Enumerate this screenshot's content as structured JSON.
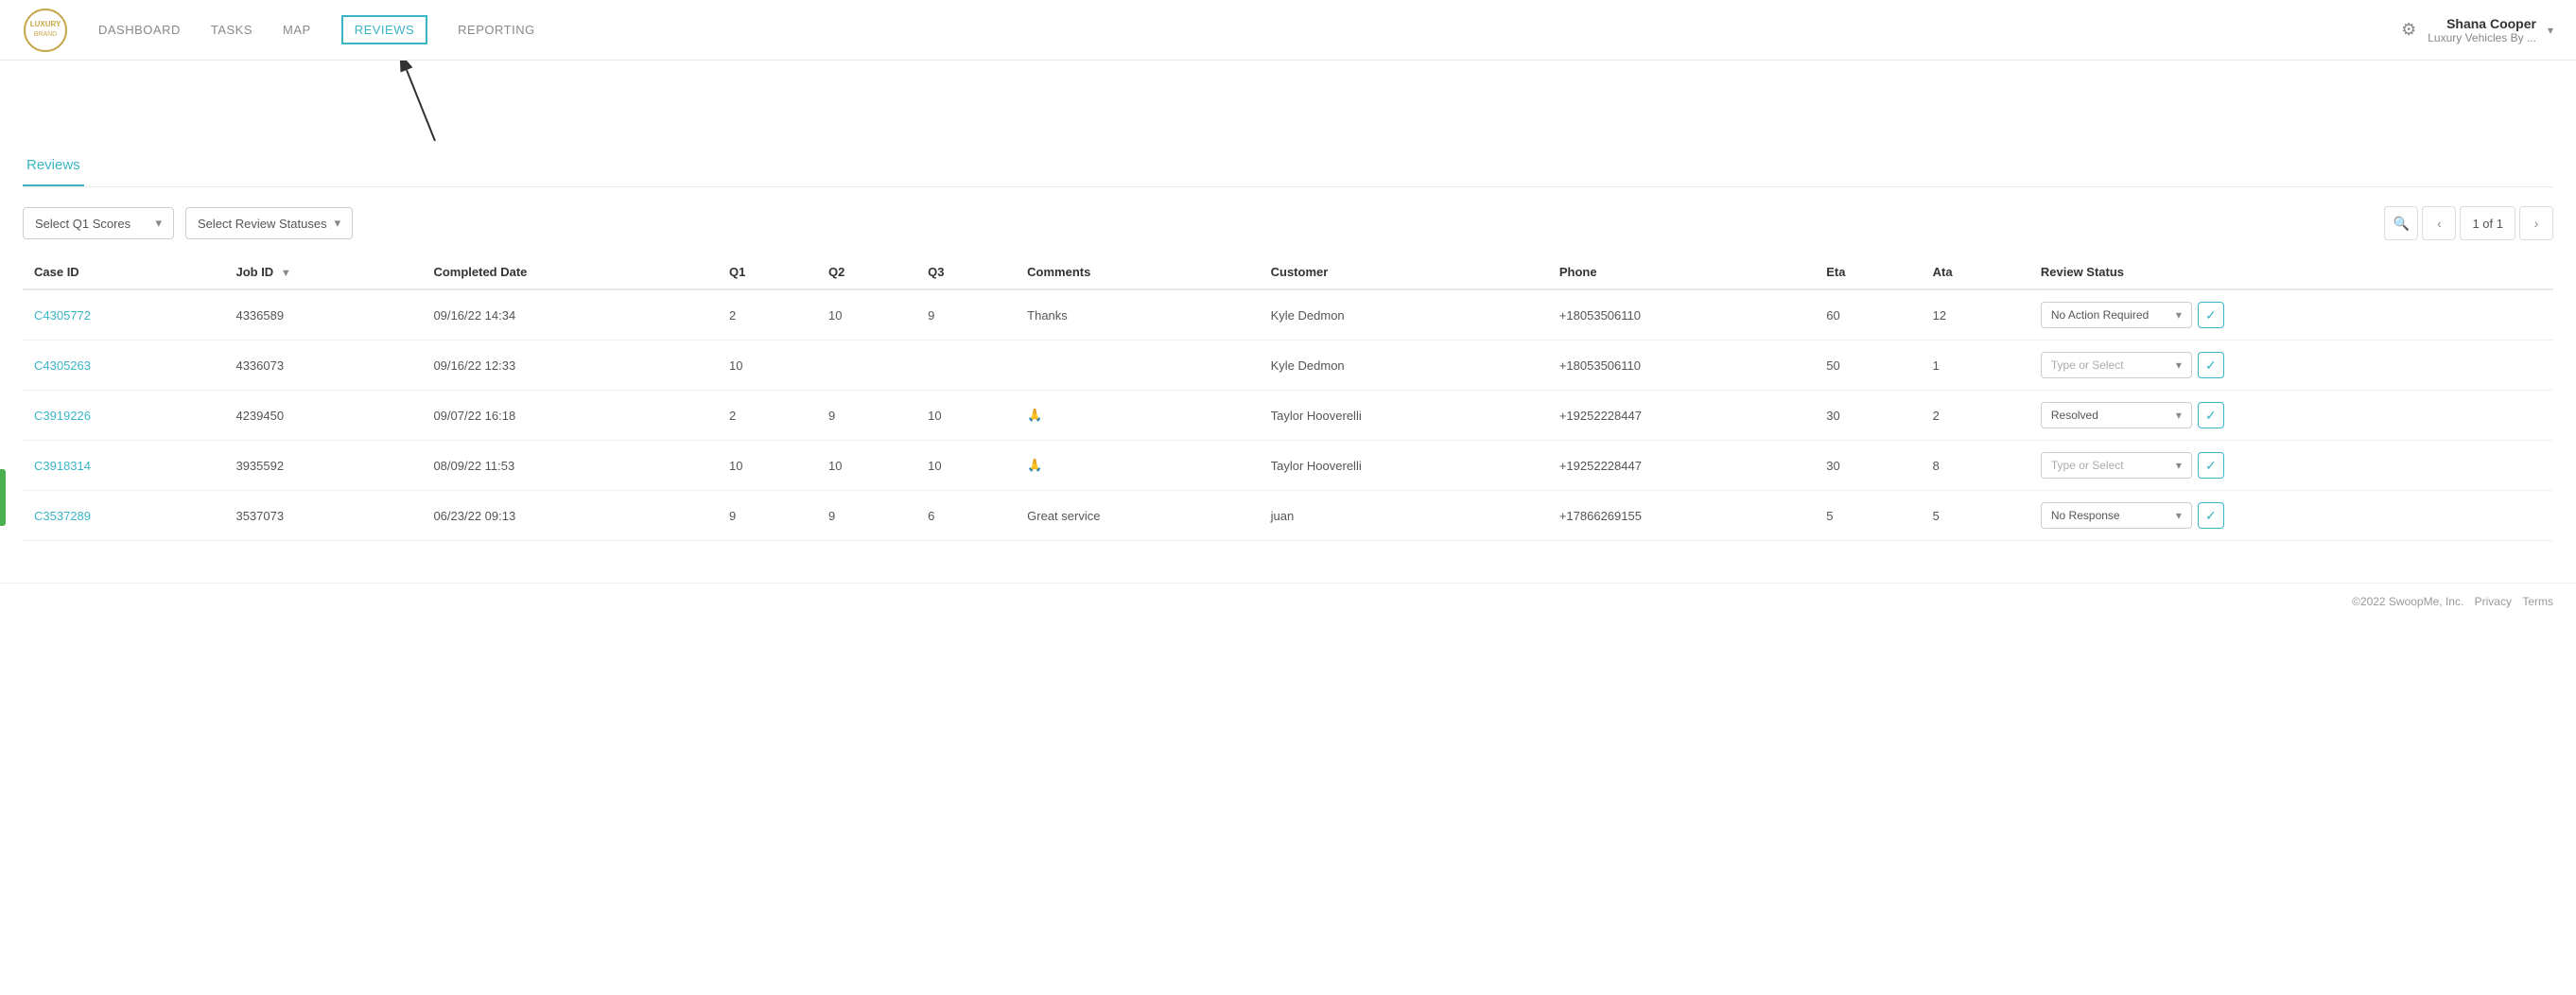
{
  "header": {
    "nav_items": [
      {
        "id": "dashboard",
        "label": "DASHBOARD",
        "active": false
      },
      {
        "id": "tasks",
        "label": "TASKS",
        "active": false
      },
      {
        "id": "map",
        "label": "MAP",
        "active": false
      },
      {
        "id": "reviews",
        "label": "REVIEWS",
        "active": true
      },
      {
        "id": "reporting",
        "label": "REPORTING",
        "active": false
      }
    ],
    "user_name": "Shana Cooper",
    "user_company": "Luxury Vehicles By ..."
  },
  "page": {
    "tab_label": "Reviews"
  },
  "filters": {
    "q1_scores_label": "Select Q1 Scores",
    "review_statuses_label": "Select Review Statuses",
    "pagination": "1 of 1"
  },
  "table": {
    "columns": [
      {
        "id": "case_id",
        "label": "Case ID"
      },
      {
        "id": "job_id",
        "label": "Job ID",
        "sortable": true
      },
      {
        "id": "completed_date",
        "label": "Completed Date"
      },
      {
        "id": "q1",
        "label": "Q1"
      },
      {
        "id": "q2",
        "label": "Q2"
      },
      {
        "id": "q3",
        "label": "Q3"
      },
      {
        "id": "comments",
        "label": "Comments"
      },
      {
        "id": "customer",
        "label": "Customer"
      },
      {
        "id": "phone",
        "label": "Phone"
      },
      {
        "id": "eta",
        "label": "Eta"
      },
      {
        "id": "ata",
        "label": "Ata"
      },
      {
        "id": "review_status",
        "label": "Review Status"
      }
    ],
    "rows": [
      {
        "case_id": "C4305772",
        "job_id": "4336589",
        "completed_date": "09/16/22 14:34",
        "q1": "2",
        "q2": "10",
        "q3": "9",
        "comments": "Thanks",
        "customer": "Kyle Dedmon",
        "phone": "+18053506110",
        "eta": "60",
        "ata": "12",
        "review_status": "No Action Required",
        "review_status_type": "selected"
      },
      {
        "case_id": "C4305263",
        "job_id": "4336073",
        "completed_date": "09/16/22 12:33",
        "q1": "10",
        "q2": "",
        "q3": "",
        "comments": "",
        "customer": "Kyle Dedmon",
        "phone": "+18053506110",
        "eta": "50",
        "ata": "1",
        "review_status": "Type or Select",
        "review_status_type": "placeholder"
      },
      {
        "case_id": "C3919226",
        "job_id": "4239450",
        "completed_date": "09/07/22 16:18",
        "q1": "2",
        "q2": "9",
        "q3": "10",
        "comments": "🙏",
        "customer": "Taylor Hooverelli",
        "phone": "+19252228447",
        "eta": "30",
        "ata": "2",
        "review_status": "Resolved",
        "review_status_type": "selected"
      },
      {
        "case_id": "C3918314",
        "job_id": "3935592",
        "completed_date": "08/09/22 11:53",
        "q1": "10",
        "q2": "10",
        "q3": "10",
        "comments": "🙏",
        "customer": "Taylor Hooverelli",
        "phone": "+19252228447",
        "eta": "30",
        "ata": "8",
        "review_status": "Type or Select",
        "review_status_type": "placeholder"
      },
      {
        "case_id": "C3537289",
        "job_id": "3537073",
        "completed_date": "06/23/22 09:13",
        "q1": "9",
        "q2": "9",
        "q3": "6",
        "comments": "Great service",
        "customer": "juan",
        "phone": "+17866269155",
        "eta": "5",
        "ata": "5",
        "review_status": "No Response",
        "review_status_type": "selected"
      }
    ]
  },
  "footer": {
    "copyright": "©2022 SwoopMe, Inc.",
    "privacy_link": "Privacy",
    "terms_link": "Terms"
  }
}
